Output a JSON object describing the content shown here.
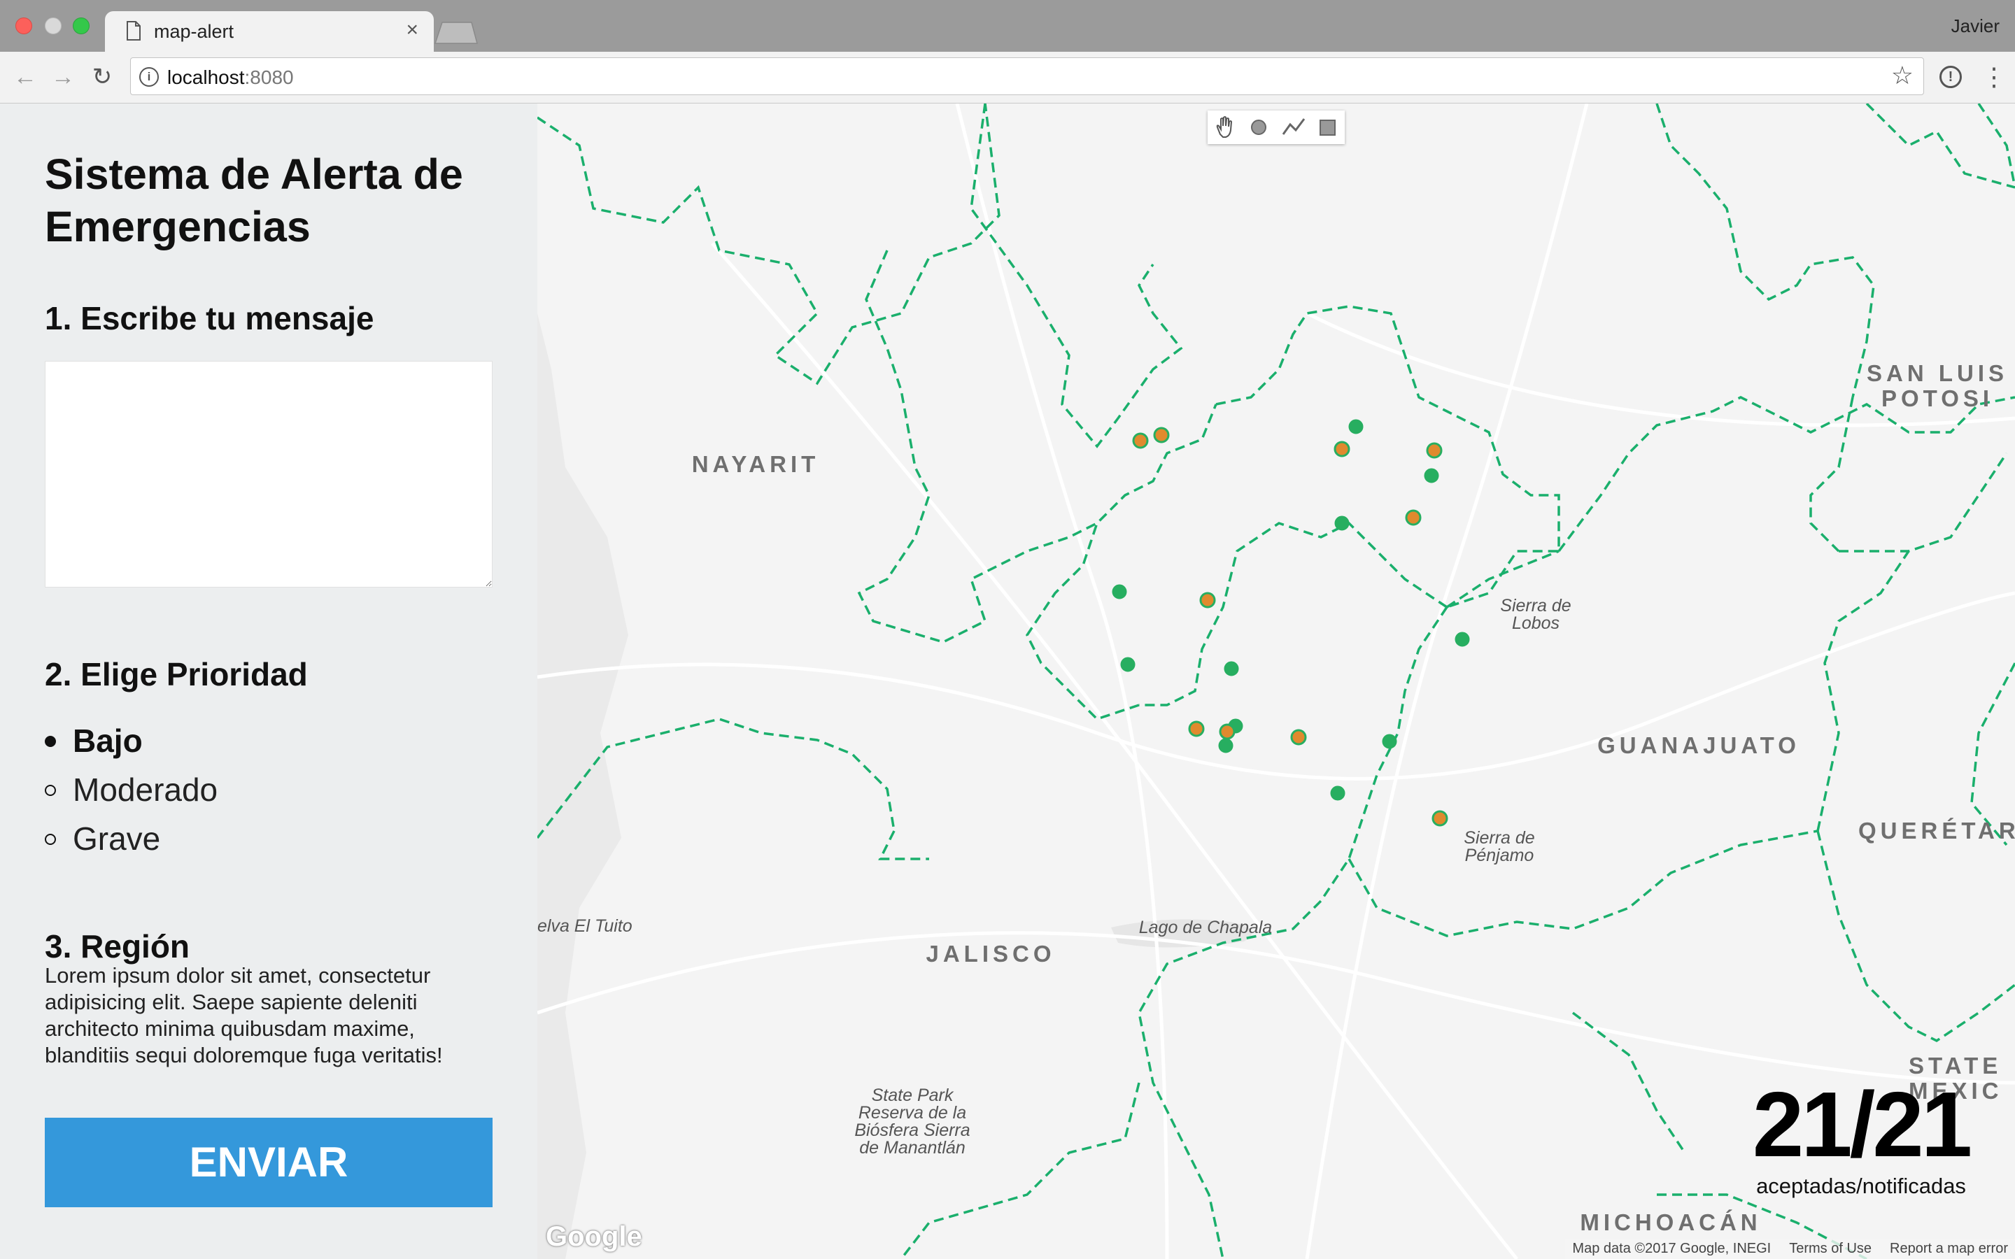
{
  "browser": {
    "tab_title": "map-alert",
    "tab_close": "×",
    "profile": "Javier",
    "url_host": "localhost",
    "url_port": ":8080"
  },
  "panel": {
    "title": "Sistema de Alerta de Emergencias",
    "step1_heading": "1. Escribe tu mensaje",
    "message_value": "",
    "step2_heading": "2. Elige Prioridad",
    "priorities": [
      {
        "label": "Bajo",
        "selected": true
      },
      {
        "label": "Moderado",
        "selected": false
      },
      {
        "label": "Grave",
        "selected": false
      }
    ],
    "step3_heading": "3. Región",
    "region_text": "Lorem ipsum dolor sit amet, consectetur adipisicing elit. Saepe sapiente deleniti architecto minima quibusdam maxime, blanditiis sequi doloremque fuga veritatis!",
    "send_label": "ENVIAR",
    "send_color": "#3498db"
  },
  "map": {
    "places": {
      "nayarit": "NAYARIT",
      "jalisco": "JALISCO",
      "guanajuato": "GUANAJUATO",
      "san_luis": "SAN LUIS POTOSI",
      "queretaro": "QUERÉTAR",
      "state_mexico": "STATE MEXIC",
      "michoacan": "MICHOACÁN",
      "sierra_lobos": "Sierra de Lobos",
      "sierra_penjamo": "Sierra de Pénjamo",
      "lago_chapala": "Lago de Chapala",
      "el_tuito": "elva El Tuito",
      "state_park": "State Park Reserva de la Biósfera Sierra de Manantlán"
    },
    "marker_colors": {
      "accepted": "#e08a2e",
      "notified": "#27ae60"
    },
    "counter": {
      "value": "21/21",
      "caption": "aceptadas/notificadas"
    },
    "google_logo": "Google",
    "footer": {
      "data": "Map data ©2017 Google, INEGI",
      "terms": "Terms of Use",
      "report": "Report a map error"
    },
    "draw_tools": [
      "hand-icon",
      "circle-icon",
      "polyline-icon",
      "rectangle-icon"
    ]
  }
}
